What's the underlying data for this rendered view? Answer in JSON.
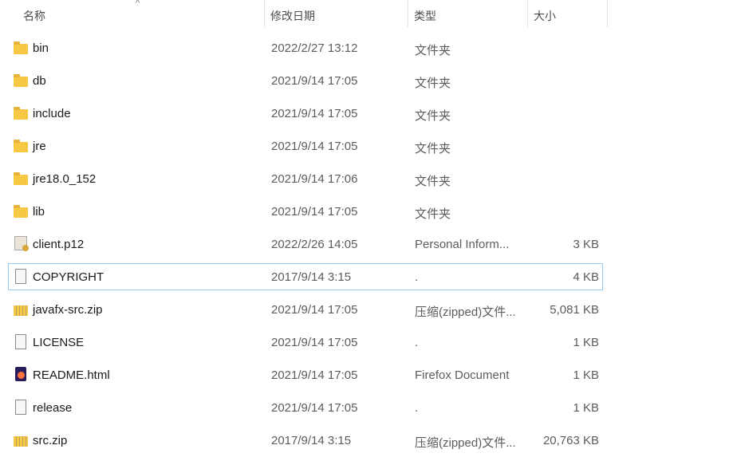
{
  "columns": {
    "name": "名称",
    "date": "修改日期",
    "type": "类型",
    "size": "大小"
  },
  "sort_indicator": "^",
  "files": [
    {
      "name": "bin",
      "date": "2022/2/27 13:12",
      "type": "文件夹",
      "size": "",
      "icon": "folder"
    },
    {
      "name": "db",
      "date": "2021/9/14 17:05",
      "type": "文件夹",
      "size": "",
      "icon": "folder"
    },
    {
      "name": "include",
      "date": "2021/9/14 17:05",
      "type": "文件夹",
      "size": "",
      "icon": "folder"
    },
    {
      "name": "jre",
      "date": "2021/9/14 17:05",
      "type": "文件夹",
      "size": "",
      "icon": "folder"
    },
    {
      "name": "jre18.0_152",
      "date": "2021/9/14 17:06",
      "type": "文件夹",
      "size": "",
      "icon": "folder"
    },
    {
      "name": "lib",
      "date": "2021/9/14 17:05",
      "type": "文件夹",
      "size": "",
      "icon": "folder"
    },
    {
      "name": "client.p12",
      "date": "2022/2/26 14:05",
      "type": "Personal Inform...",
      "size": "3 KB",
      "icon": "cert"
    },
    {
      "name": "COPYRIGHT",
      "date": "2017/9/14 3:15",
      "type": ".",
      "size": "4 KB",
      "icon": "file",
      "selected": true
    },
    {
      "name": "javafx-src.zip",
      "date": "2021/9/14 17:05",
      "type": "压缩(zipped)文件...",
      "size": "5,081 KB",
      "icon": "zip"
    },
    {
      "name": "LICENSE",
      "date": "2021/9/14 17:05",
      "type": ".",
      "size": "1 KB",
      "icon": "file"
    },
    {
      "name": "README.html",
      "date": "2021/9/14 17:05",
      "type": "Firefox Document",
      "size": "1 KB",
      "icon": "ff"
    },
    {
      "name": "release",
      "date": "2021/9/14 17:05",
      "type": ".",
      "size": "1 KB",
      "icon": "file"
    },
    {
      "name": "src.zip",
      "date": "2017/9/14 3:15",
      "type": "压缩(zipped)文件...",
      "size": "20,763 KB",
      "icon": "zip"
    }
  ]
}
